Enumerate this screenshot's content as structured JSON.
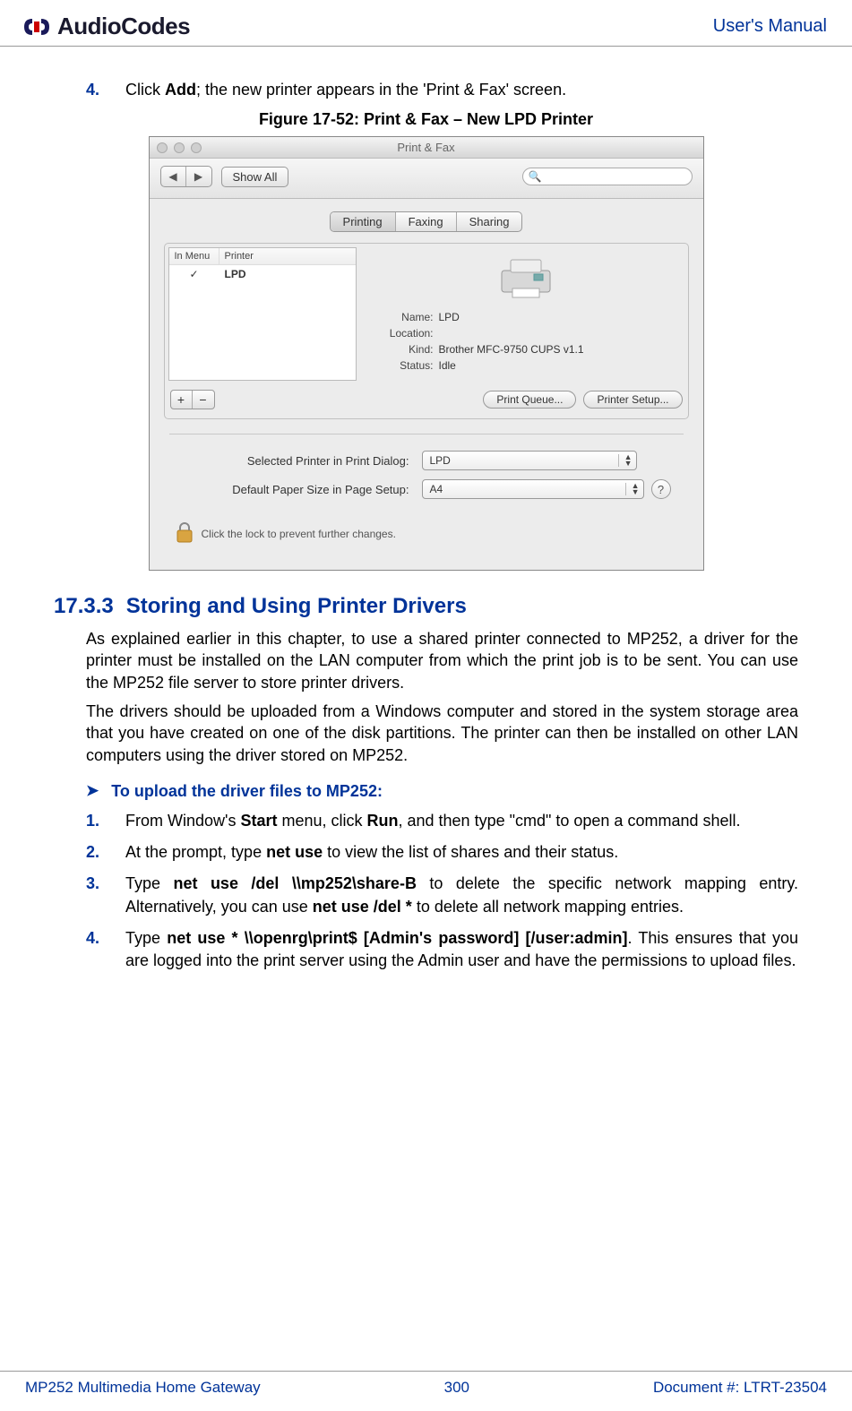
{
  "header": {
    "logo_text": "AudioCodes",
    "manual_title": "User's Manual"
  },
  "step4": {
    "num": "4.",
    "prefix": "Click ",
    "bold": "Add",
    "suffix": "; the new printer appears in the 'Print & Fax' screen."
  },
  "figure_caption": "Figure 17-52: Print & Fax – New LPD Printer",
  "mac": {
    "title": "Print & Fax",
    "showall": "Show All",
    "tabs": {
      "printing": "Printing",
      "faxing": "Faxing",
      "sharing": "Sharing"
    },
    "list_headers": {
      "inmenu": "In Menu",
      "printer": "Printer"
    },
    "printer_row": {
      "name": "LPD"
    },
    "details": {
      "name_label": "Name:",
      "name_value": "LPD",
      "location_label": "Location:",
      "location_value": "",
      "kind_label": "Kind:",
      "kind_value": "Brother MFC-9750 CUPS v1.1",
      "status_label": "Status:",
      "status_value": "Idle"
    },
    "btn_print_queue": "Print Queue...",
    "btn_printer_setup": "Printer Setup...",
    "sel1_label": "Selected Printer in Print Dialog:",
    "sel1_value": "LPD",
    "sel2_label": "Default Paper Size in Page Setup:",
    "sel2_value": "A4",
    "lock_text": "Click the lock to prevent further changes."
  },
  "section": {
    "num": "17.3.3",
    "title": "Storing and Using Printer Drivers",
    "para1": "As explained earlier in this chapter, to use a shared printer connected to MP252, a driver for the printer must be installed on the LAN computer from which the print job is to be sent. You can use the MP252 file server to store printer drivers.",
    "para2": "The drivers should be uploaded from a Windows computer and stored in the system storage area that you have created on one of the disk partitions. The printer can then be installed on other LAN computers using the driver stored on MP252."
  },
  "proc_heading": "To upload the driver files to MP252:",
  "steps": {
    "s1": {
      "num": "1.",
      "p1": "From Window's ",
      "b1": "Start",
      "p2": " menu, click ",
      "b2": "Run",
      "p3": ", and then type \"cmd\" to open a command shell."
    },
    "s2": {
      "num": "2.",
      "p1": "At the prompt, type ",
      "b1": "net use",
      "p2": " to view the list of shares and their status."
    },
    "s3": {
      "num": "3.",
      "p1": "Type ",
      "b1": "net use /del \\\\mp252\\share-B",
      "p2": " to delete the specific network mapping entry. Alternatively, you can use ",
      "b2": "net use /del *",
      "p3": " to delete all network mapping entries."
    },
    "s4": {
      "num": "4.",
      "p1": "Type ",
      "b1": "net use * \\\\openrg\\print$ [Admin's password] [/user:admin]",
      "p2": ". This ensures that you are logged into the print server using the Admin user and have the permissions to upload files."
    }
  },
  "footer": {
    "left": "MP252 Multimedia Home Gateway",
    "center": "300",
    "right": "Document #: LTRT-23504"
  }
}
